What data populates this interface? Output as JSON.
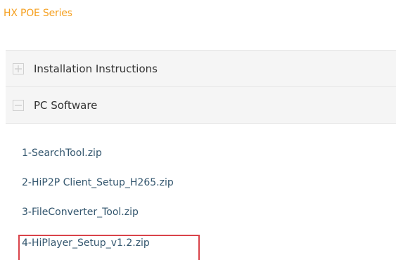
{
  "header": {
    "series_title": "HX POE Series"
  },
  "accordion": {
    "items": [
      {
        "label": "Installation Instructions",
        "state": "collapsed",
        "icon": "plus-box-icon"
      },
      {
        "label": "PC Software",
        "state": "expanded",
        "icon": "minus-box-icon"
      }
    ]
  },
  "files": [
    {
      "label": "1-SearchTool.zip"
    },
    {
      "label": "2-HiP2P Client_Setup_H265.zip"
    },
    {
      "label": "3-FileConverter_Tool.zip"
    },
    {
      "label": "4-HiPlayer_Setup_v1.2.zip",
      "highlighted": true
    }
  ],
  "colors": {
    "series_title": "#f5a020",
    "file_link": "#33566e",
    "highlight_border": "#d9434a"
  }
}
